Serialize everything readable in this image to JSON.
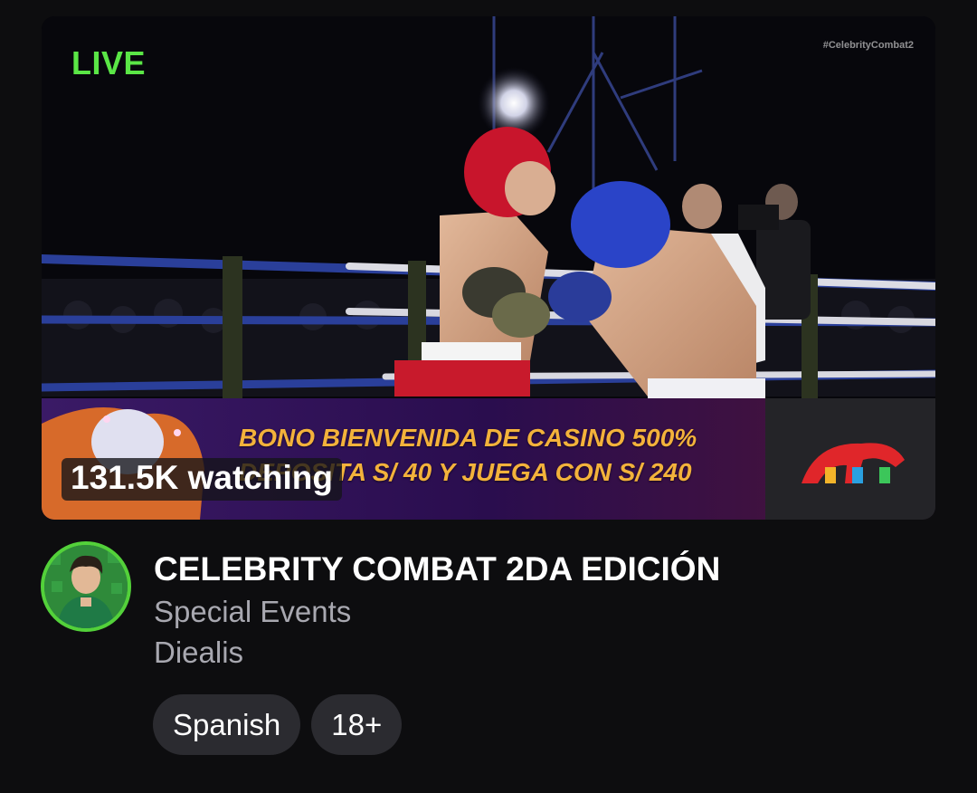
{
  "stream": {
    "live_label": "LIVE",
    "hashtag": "#CelebrityCombat2",
    "promo_line1": "BONO BIENVENIDA DE CASINO 500%",
    "promo_line2": "DEPOSITA S/ 40 Y JUEGA CON S/ 240",
    "viewers": "131.5K watching",
    "title": "CELEBRITY COMBAT 2DA EDICIÓN",
    "category": "Special Events",
    "channel": "Diealis",
    "tags": [
      "Spanish",
      "18+"
    ]
  },
  "colors": {
    "live": "#5ae646",
    "avatar_ring": "#53d13a",
    "promo_text": "#f3b23b",
    "secondary_text": "#a8a8b0",
    "tag_bg": "#2b2b30",
    "background": "#0d0d0f"
  },
  "icons": {
    "avatar": "channel-avatar-image",
    "sponsor": "dinosaur-logo-icon"
  }
}
